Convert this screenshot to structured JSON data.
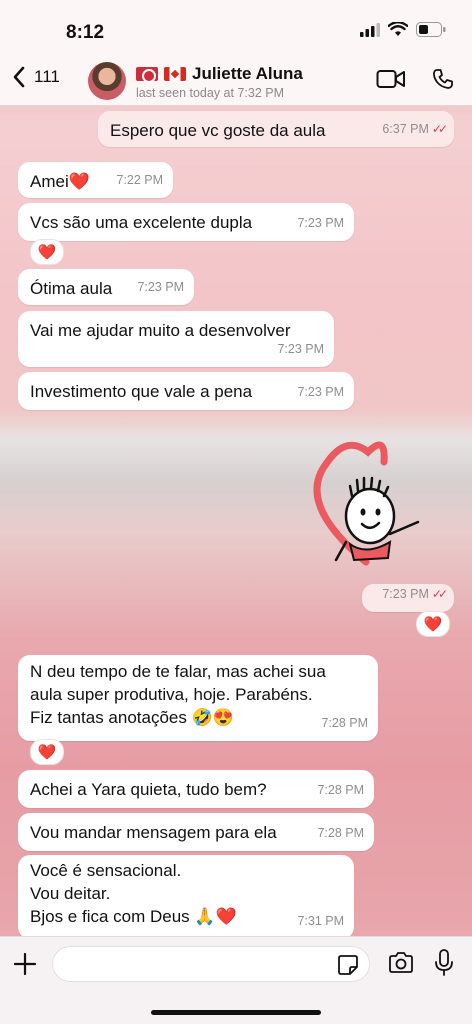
{
  "status": {
    "time": "8:12"
  },
  "header": {
    "back_count": "111",
    "contact_name": "Juliette Aluna",
    "last_seen": "last seen today at 7:32 PM"
  },
  "messages": [
    {
      "dir": "out",
      "text": "Espero que vc goste da aula",
      "time": "6:37 PM"
    },
    {
      "dir": "in",
      "text": "Amei❤️",
      "time": "7:22 PM"
    },
    {
      "dir": "in",
      "text": "Vcs são uma excelente dupla",
      "time": "7:23 PM",
      "reaction": "❤️"
    },
    {
      "dir": "in",
      "text": "Ótima aula",
      "time": "7:23 PM"
    },
    {
      "dir": "in",
      "text": "Vai me ajudar muito a desenvolver",
      "time": "7:23 PM"
    },
    {
      "dir": "in",
      "text": "Investimento que vale a pena",
      "time": "7:23 PM"
    },
    {
      "dir": "out",
      "text": "",
      "time": "7:23 PM",
      "reaction": "❤️"
    },
    {
      "dir": "in",
      "lines": [
        "N deu tempo de te falar, mas achei sua",
        "aula super produtiva, hoje. Parabéns.",
        "Fiz tantas anotações 🤣😍"
      ],
      "time": "7:28 PM",
      "reaction": "❤️"
    },
    {
      "dir": "in",
      "text": "Achei a Yara quieta, tudo bem?",
      "time": "7:28 PM"
    },
    {
      "dir": "in",
      "text": "Vou mandar mensagem para ela",
      "time": "7:28 PM"
    },
    {
      "dir": "in",
      "lines": [
        "Você é sensacional.",
        "Vou deitar.",
        "Bjos e fica com Deus 🙏❤️"
      ],
      "time": "7:31 PM"
    }
  ],
  "colors": {
    "accent": "#d9434f",
    "incoming": "#ffffff",
    "outgoing": "#fbe9ea"
  }
}
